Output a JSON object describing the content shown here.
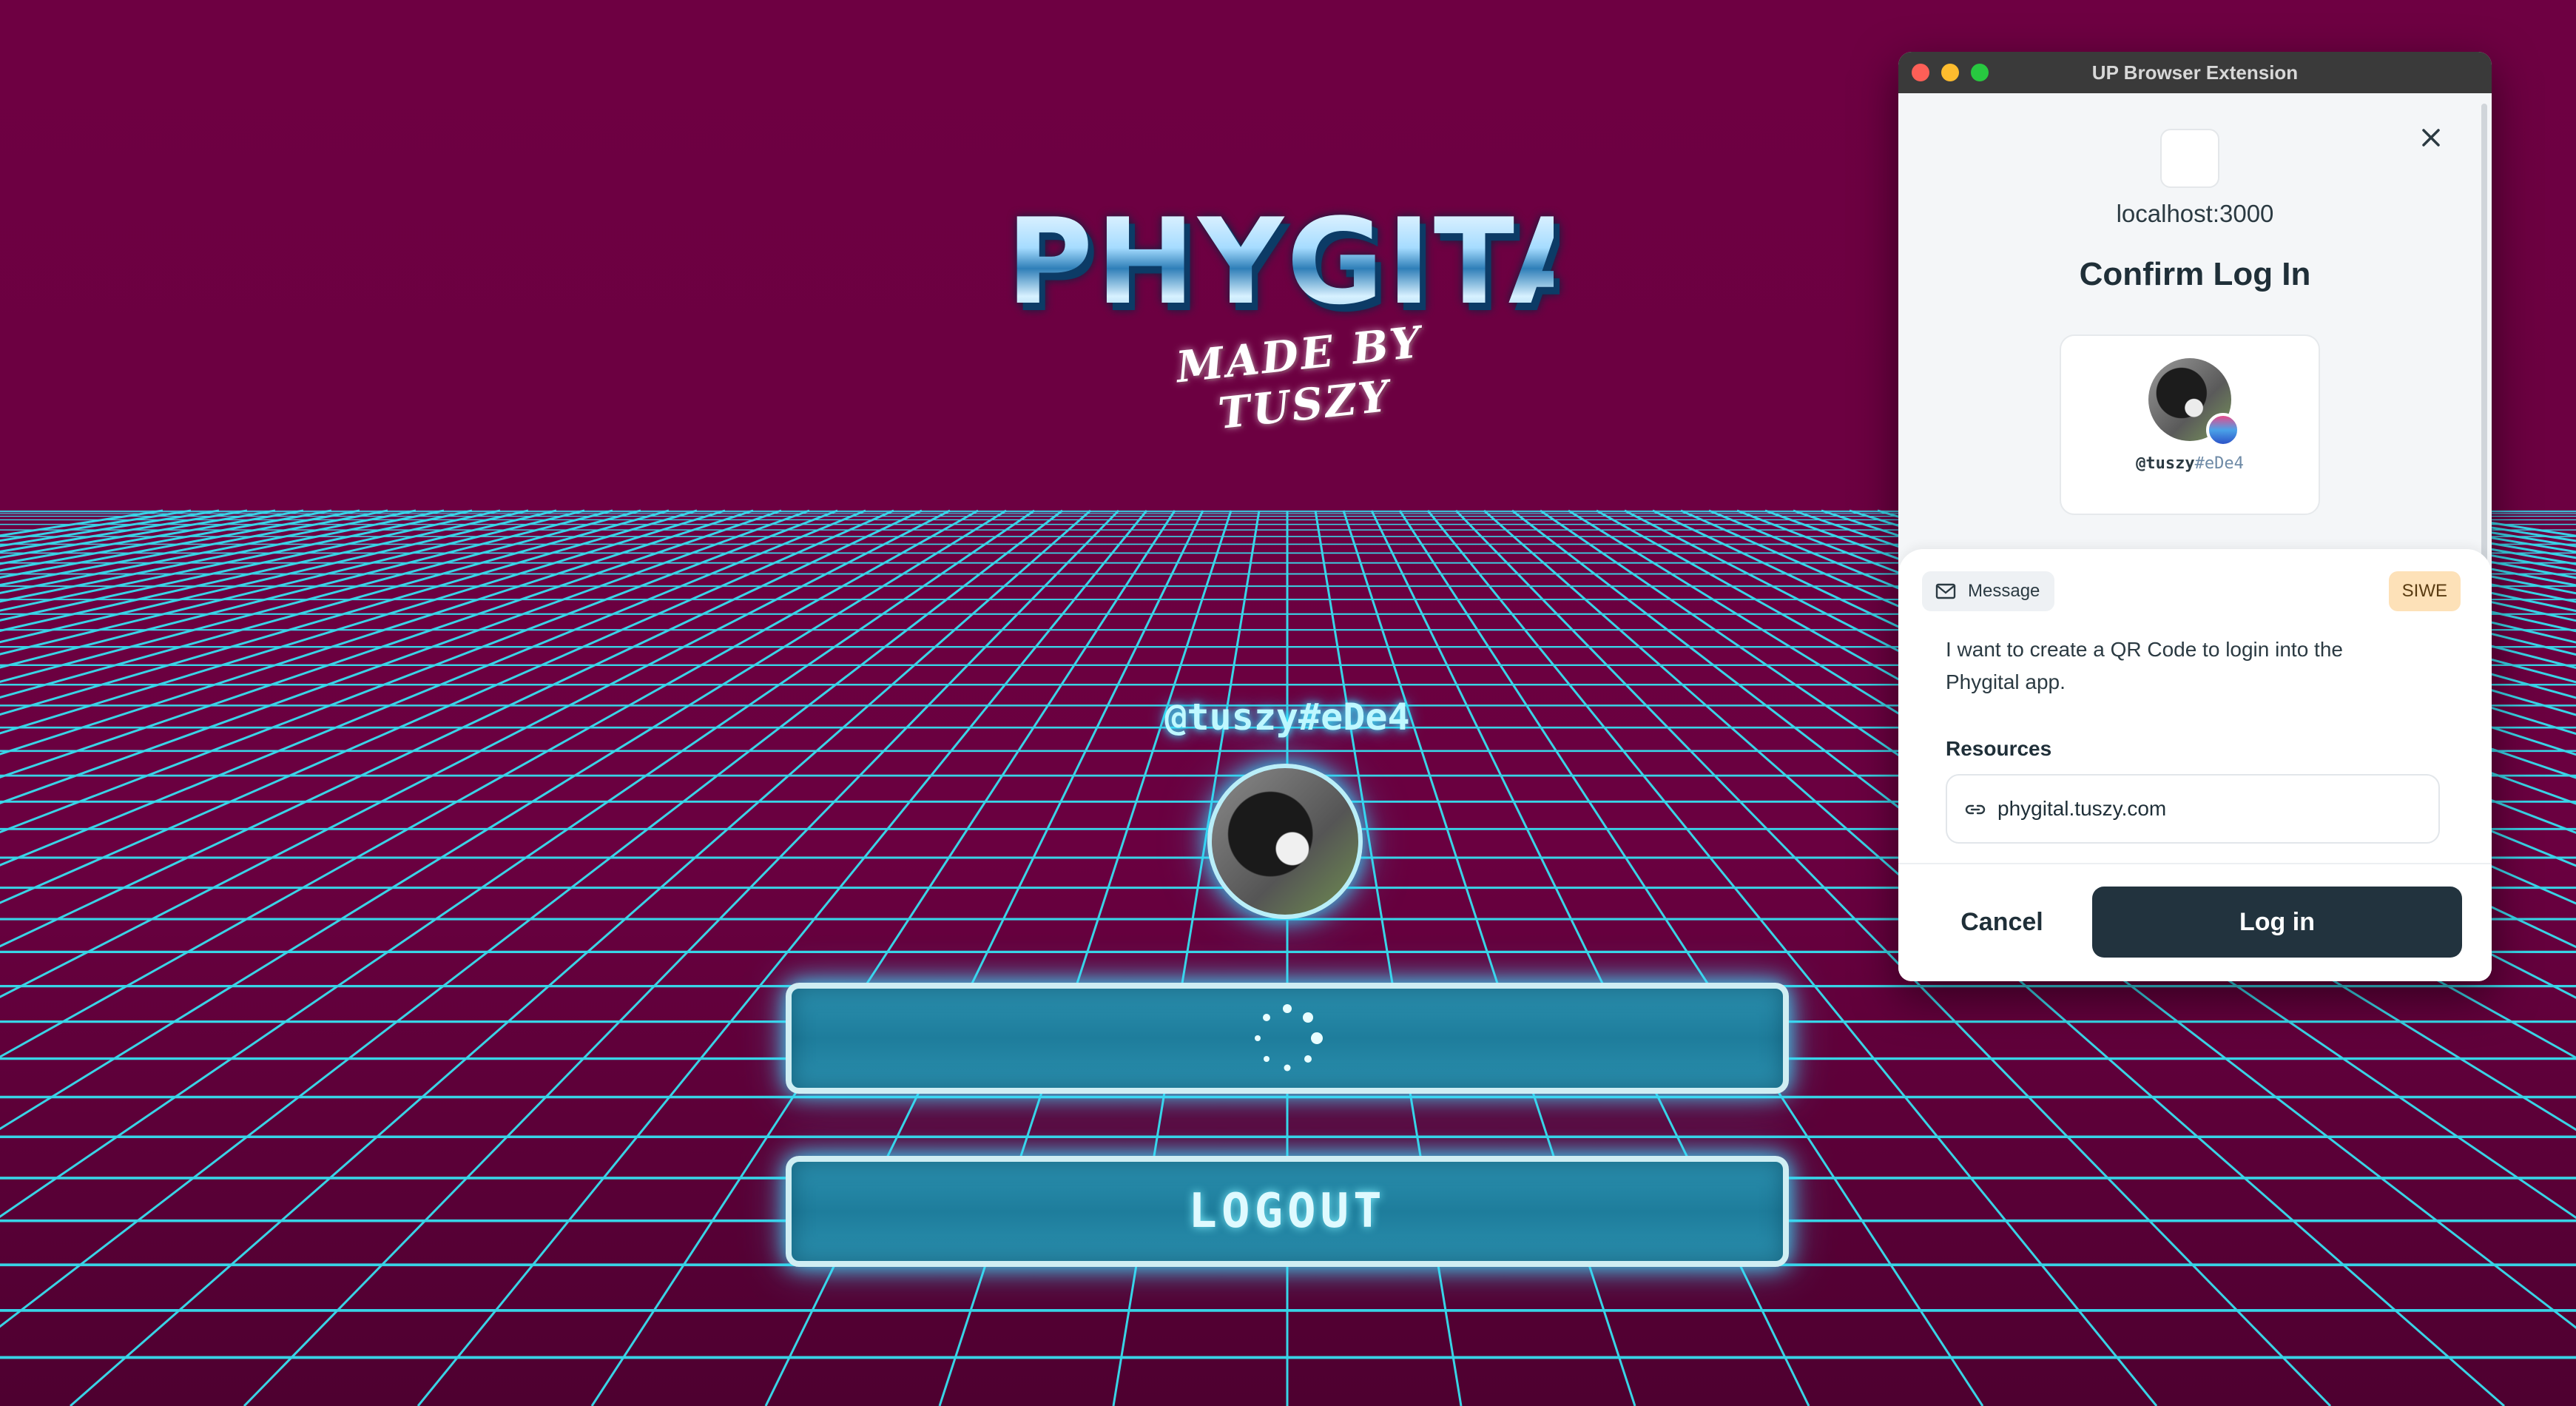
{
  "app": {
    "logo_title": "PHYGITAL",
    "logo_subtitle": "MADE BY TUSZY",
    "username": "@tuszy#eDe4",
    "buttons": {
      "qr_label": "",
      "logout_label": "LOGOUT"
    }
  },
  "extension": {
    "window_title": "UP Browser Extension",
    "host": "localhost:3000",
    "heading": "Confirm Log In",
    "profile": {
      "name": "@tuszy",
      "tag": "#eDe4"
    },
    "message": {
      "chip_label": "Message",
      "badge": "SIWE",
      "text": "I want to create a QR Code to login into the Phygital app.",
      "resources_title": "Resources",
      "resource_url": "phygital.tuszy.com"
    },
    "cancel_label": "Cancel",
    "login_label": "Log in"
  },
  "colors": {
    "background": "#5d0036",
    "grid": "#37e0f0",
    "button_fill": "#1e7d9c",
    "extension_primary": "#22333e",
    "siwe_badge": "#fde1b8"
  },
  "icons": [
    "close-icon",
    "mail-icon",
    "link-icon",
    "spinner-icon"
  ]
}
